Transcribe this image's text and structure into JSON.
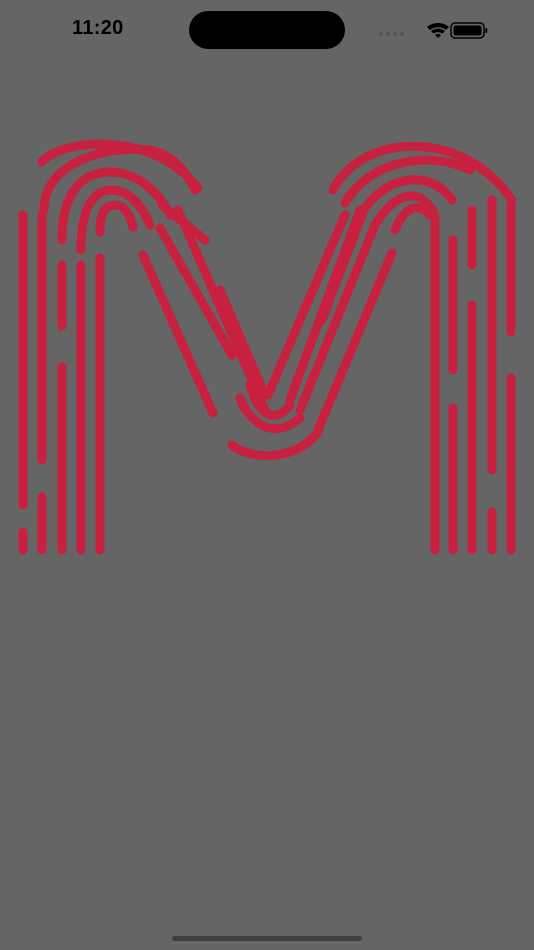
{
  "status_bar": {
    "time": "11:20",
    "icons": [
      "signal-dots-icon",
      "wifi-icon",
      "battery-icon"
    ]
  },
  "splash": {
    "logo": "m-logo",
    "colors": {
      "background": "#666565",
      "logo": "#c8213f"
    }
  }
}
